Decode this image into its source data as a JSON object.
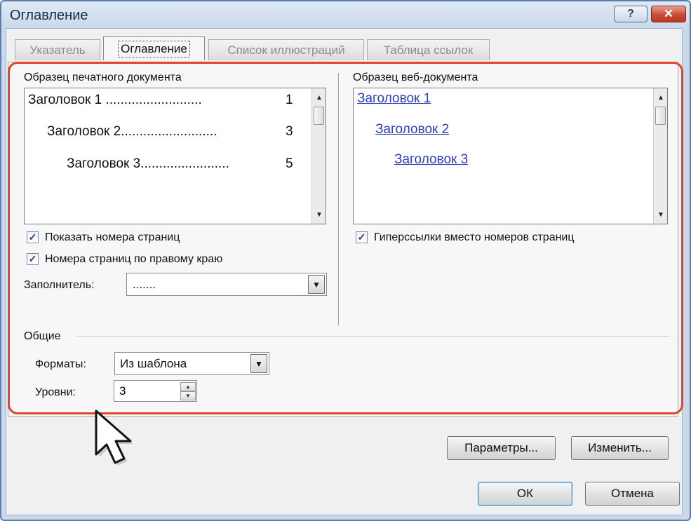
{
  "window": {
    "title": "Оглавление"
  },
  "titlebar": {
    "help_glyph": "?",
    "close_glyph": "✕"
  },
  "tabs": [
    {
      "label": "Указатель",
      "active": false
    },
    {
      "label": "Оглавление",
      "active": true
    },
    {
      "label": "Список иллюстраций",
      "active": false
    },
    {
      "label": "Таблица ссылок",
      "active": false
    }
  ],
  "print_preview": {
    "label": "Образец печатного документа",
    "items": [
      {
        "text": "Заголовок 1",
        "dots": "..........................",
        "page": "1"
      },
      {
        "text": "Заголовок 2",
        "dots": "..........................",
        "page": "3"
      },
      {
        "text": "Заголовок 3",
        "dots": "........................",
        "page": "5"
      }
    ]
  },
  "web_preview": {
    "label": "Образец веб-документа",
    "items": [
      "Заголовок 1",
      "Заголовок 2",
      "Заголовок 3"
    ]
  },
  "options": {
    "show_page_numbers": {
      "label": "Показать номера страниц",
      "checked": true
    },
    "right_align": {
      "label": "Номера страниц по правому краю",
      "checked": true
    },
    "hyperlinks": {
      "label": "Гиперссылки вместо номеров страниц",
      "checked": true
    },
    "check_glyph": "✓"
  },
  "leader": {
    "label": "Заполнитель:",
    "value": "......."
  },
  "general": {
    "label": "Общие",
    "formats": {
      "label": "Форматы:",
      "value": "Из шаблона"
    },
    "levels": {
      "label": "Уровни:",
      "value": "3"
    }
  },
  "glyphs": {
    "dropdown": "▼",
    "scroll_up": "▲",
    "scroll_down": "▼",
    "spin_up": "▲",
    "spin_down": "▼"
  },
  "buttons": {
    "params": "Параметры...",
    "modify": "Изменить...",
    "ok": "ОК",
    "cancel": "Отмена"
  }
}
